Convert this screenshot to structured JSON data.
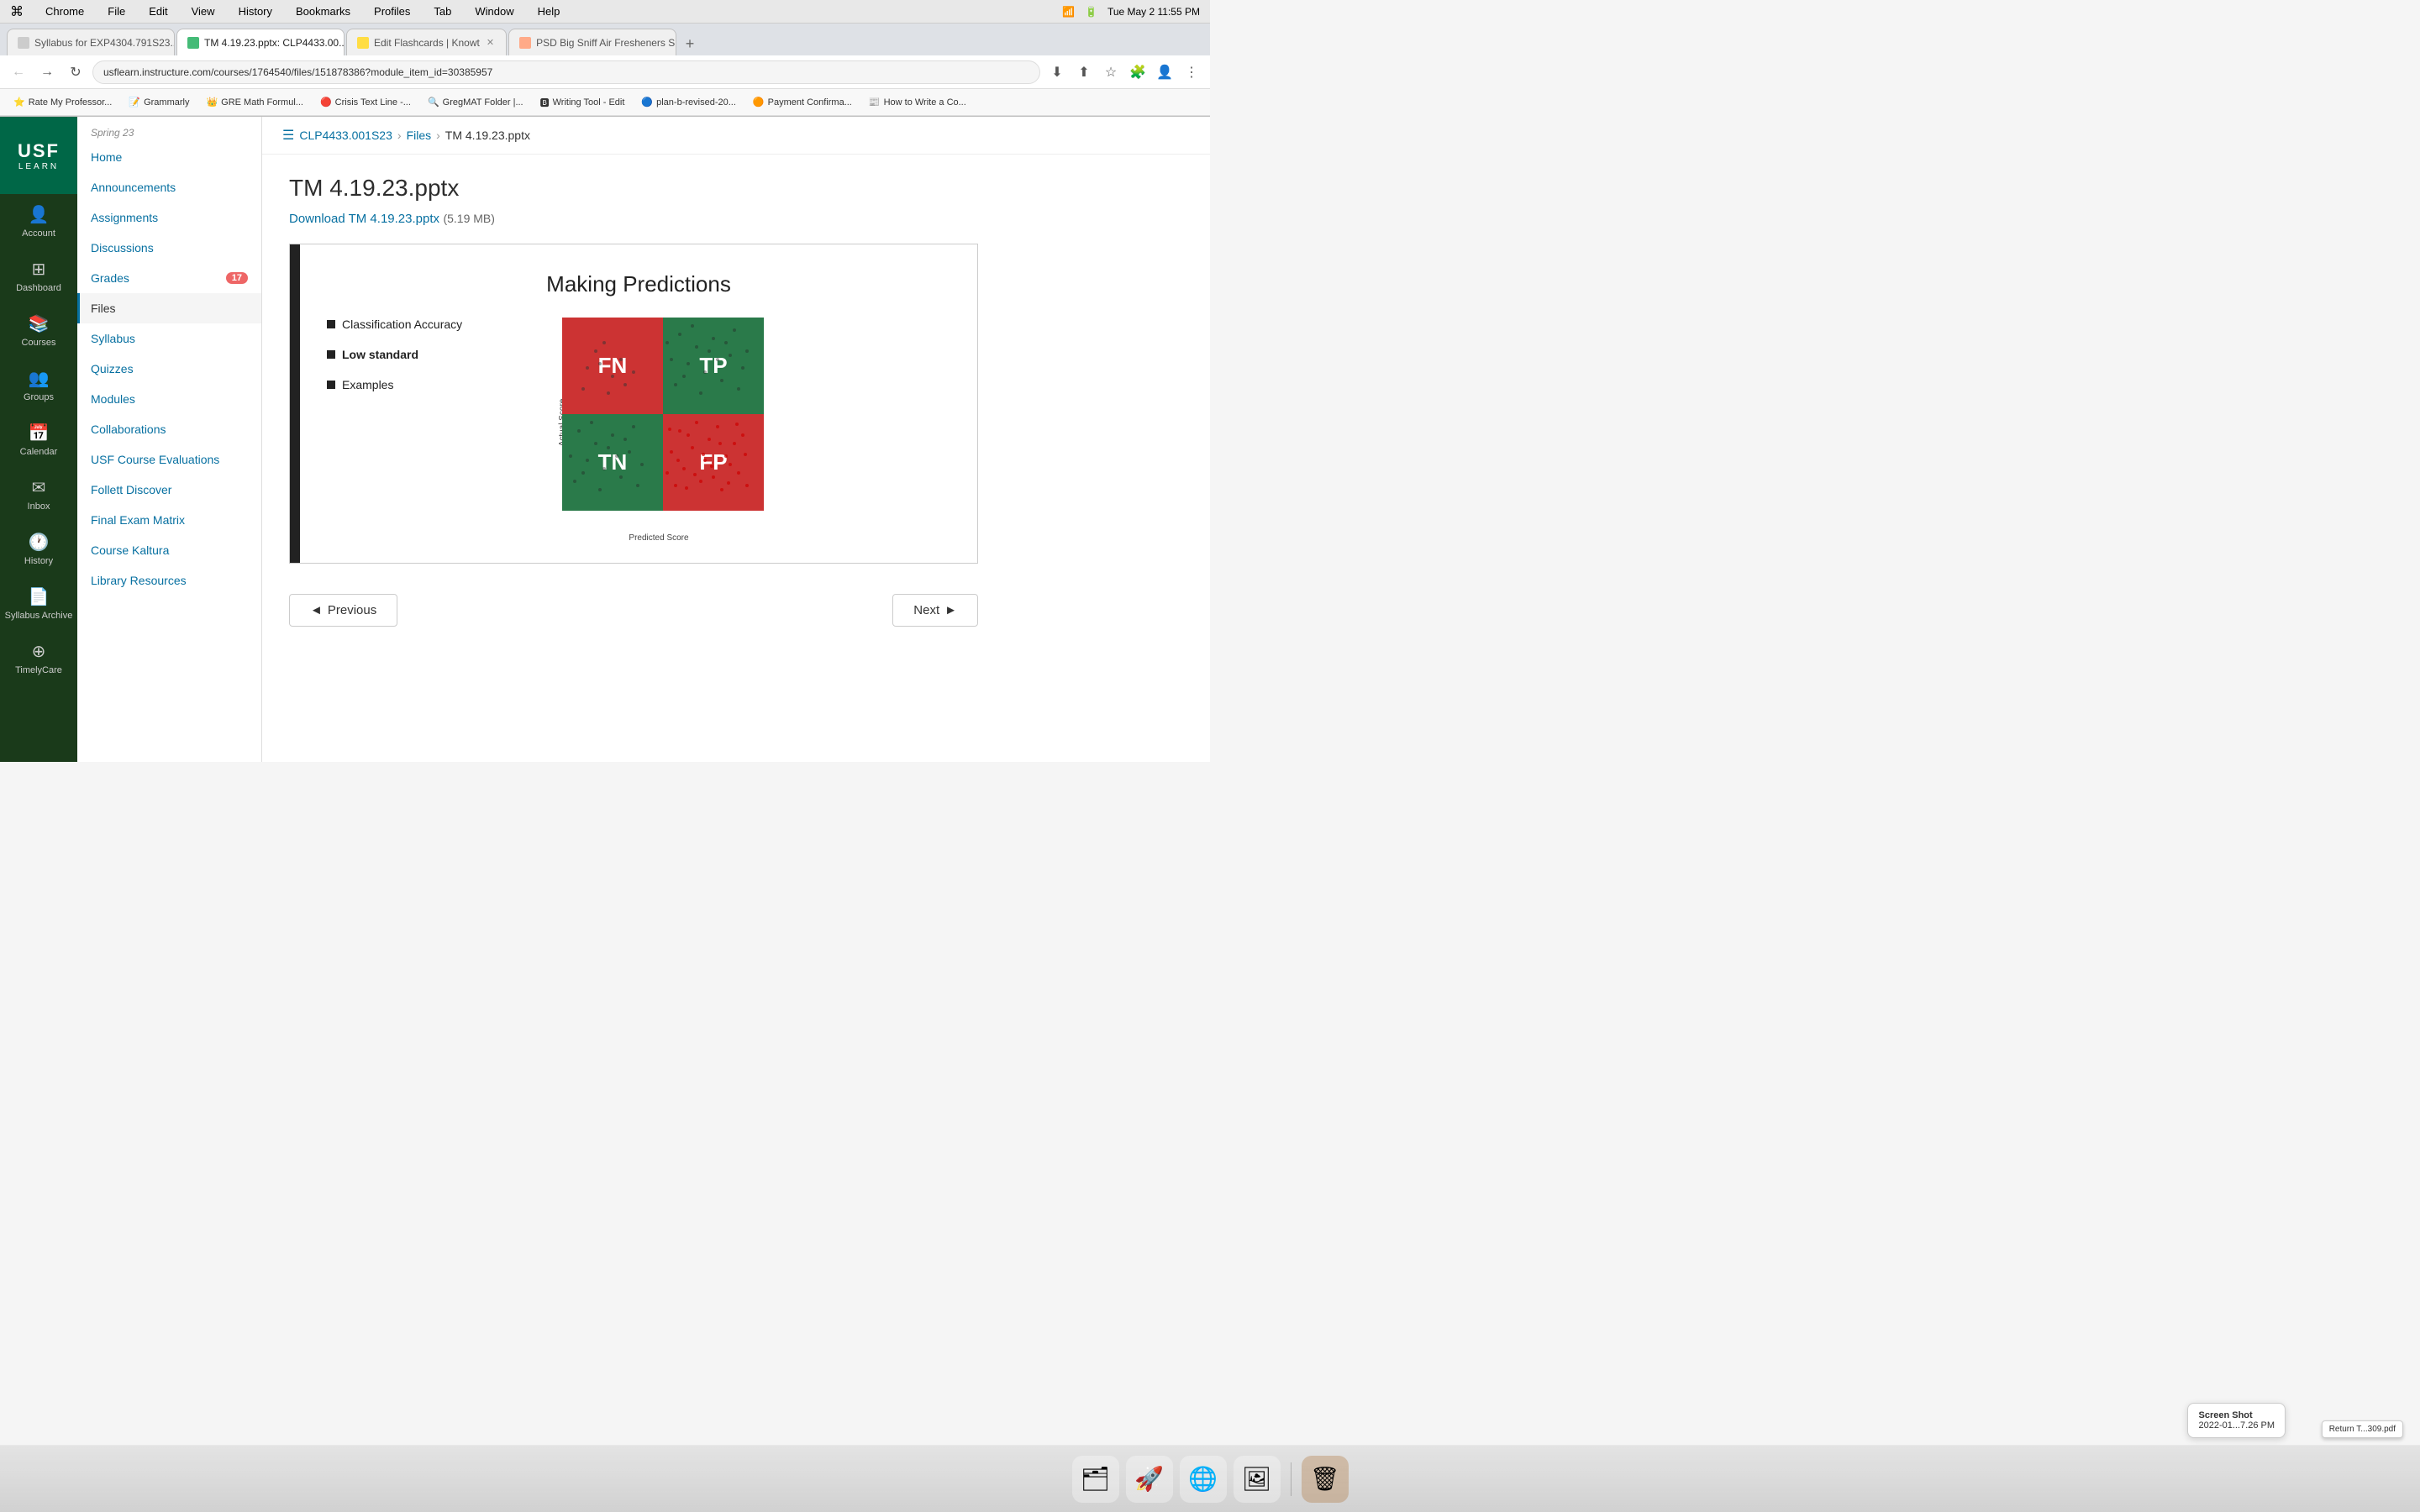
{
  "mac_menubar": {
    "apple": "⌘",
    "app_name": "Chrome",
    "menus": [
      "File",
      "Edit",
      "View",
      "History",
      "Bookmarks",
      "Profiles",
      "Tab",
      "Window",
      "Help"
    ],
    "time": "Tue May 2  11:55 PM",
    "battery_icon": "🔋"
  },
  "browser": {
    "tabs": [
      {
        "id": "tab1",
        "title": "Syllabus for EXP4304.791S23...",
        "favicon_color": "#e8e8e8",
        "active": false,
        "closeable": true
      },
      {
        "id": "tab2",
        "title": "TM 4.19.23.pptx: CLP4433.00...",
        "favicon_color": "#4e9",
        "active": true,
        "closeable": true
      },
      {
        "id": "tab3",
        "title": "Edit Flashcards | Knowt",
        "favicon_color": "#ff9",
        "active": false,
        "closeable": true
      },
      {
        "id": "tab4",
        "title": "PSD Big Sniff Air Fresheners S...",
        "favicon_color": "#faa",
        "active": false,
        "closeable": true
      }
    ],
    "address": "usflearn.instructure.com/courses/1764540/files/151878386?module_item_id=30385957",
    "bookmarks": [
      "Rate My Professor...",
      "Grammarly",
      "GRE Math Formul...",
      "Crisis Text Line -...",
      "GregMAT Folder |...",
      "Writing Tool - Edit",
      "plan-b-revised-20...",
      "Payment Confirma...",
      "How to Write a Co..."
    ]
  },
  "global_nav": {
    "logo_text": "USF",
    "logo_sub": "LEARN",
    "items": [
      {
        "id": "account",
        "icon": "👤",
        "label": "Account"
      },
      {
        "id": "dashboard",
        "icon": "⊞",
        "label": "Dashboard"
      },
      {
        "id": "courses",
        "icon": "📚",
        "label": "Courses"
      },
      {
        "id": "groups",
        "icon": "👥",
        "label": "Groups"
      },
      {
        "id": "calendar",
        "icon": "📅",
        "label": "Calendar"
      },
      {
        "id": "inbox",
        "icon": "✉",
        "label": "Inbox"
      },
      {
        "id": "history",
        "icon": "🕐",
        "label": "History"
      },
      {
        "id": "syllabus_archive",
        "icon": "📄",
        "label": "Syllabus Archive"
      },
      {
        "id": "timelycare",
        "icon": "⊕",
        "label": "TimelyCare"
      }
    ]
  },
  "course_sidebar": {
    "semester": "Spring 23",
    "items": [
      {
        "id": "home",
        "label": "Home",
        "active": false,
        "badge": null
      },
      {
        "id": "announcements",
        "label": "Announcements",
        "active": false,
        "badge": null
      },
      {
        "id": "assignments",
        "label": "Assignments",
        "active": false,
        "badge": null
      },
      {
        "id": "discussions",
        "label": "Discussions",
        "active": false,
        "badge": null
      },
      {
        "id": "grades",
        "label": "Grades",
        "active": false,
        "badge": "17"
      },
      {
        "id": "files",
        "label": "Files",
        "active": true,
        "badge": null
      },
      {
        "id": "syllabus",
        "label": "Syllabus",
        "active": false,
        "badge": null
      },
      {
        "id": "quizzes",
        "label": "Quizzes",
        "active": false,
        "badge": null
      },
      {
        "id": "modules",
        "label": "Modules",
        "active": false,
        "badge": null
      },
      {
        "id": "collaborations",
        "label": "Collaborations",
        "active": false,
        "badge": null
      },
      {
        "id": "usf_course_evals",
        "label": "USF Course Evaluations",
        "active": false,
        "badge": null
      },
      {
        "id": "follett",
        "label": "Follett Discover",
        "active": false,
        "badge": null
      },
      {
        "id": "final_exam",
        "label": "Final Exam Matrix",
        "active": false,
        "badge": null
      },
      {
        "id": "course_kaltura",
        "label": "Course Kaltura",
        "active": false,
        "badge": null
      },
      {
        "id": "library",
        "label": "Library Resources",
        "active": false,
        "badge": null
      }
    ]
  },
  "breadcrumb": {
    "course": "CLP4433.001S23",
    "section": "Files",
    "current": "TM 4.19.23.pptx"
  },
  "file_viewer": {
    "title": "TM 4.19.23.pptx",
    "download_text": "Download TM 4.19.23.pptx",
    "file_size": "(5.19 MB)",
    "slide": {
      "title": "Making Predictions",
      "bullets": [
        {
          "text": "Classification Accuracy",
          "bold": false
        },
        {
          "text": "Low standard",
          "bold": true
        },
        {
          "text": "Examples",
          "bold": false
        }
      ],
      "matrix": {
        "cells": [
          "FN",
          "TP",
          "TN",
          "FP"
        ],
        "y_label": "Actual Score",
        "x_label": "Predicted Score"
      }
    },
    "nav": {
      "previous": "◄ Previous",
      "next": "Next ►"
    }
  },
  "dock": {
    "items": [
      {
        "id": "finder",
        "icon": "🗂",
        "label": "Finder"
      },
      {
        "id": "launchpad",
        "icon": "🚀",
        "label": "Launchpad"
      },
      {
        "id": "chrome",
        "icon": "🌐",
        "label": "Chrome"
      },
      {
        "id": "preview",
        "icon": "🖼",
        "label": "Preview"
      },
      {
        "id": "trash",
        "icon": "🗑",
        "label": "Trash"
      }
    ],
    "screenshot_notif": {
      "title": "Screen Shot",
      "subtitle": "2022-01...7.26 PM"
    }
  },
  "bottom_files": [
    {
      "id": "pdf1",
      "label": "Return T...309.pdf"
    }
  ]
}
